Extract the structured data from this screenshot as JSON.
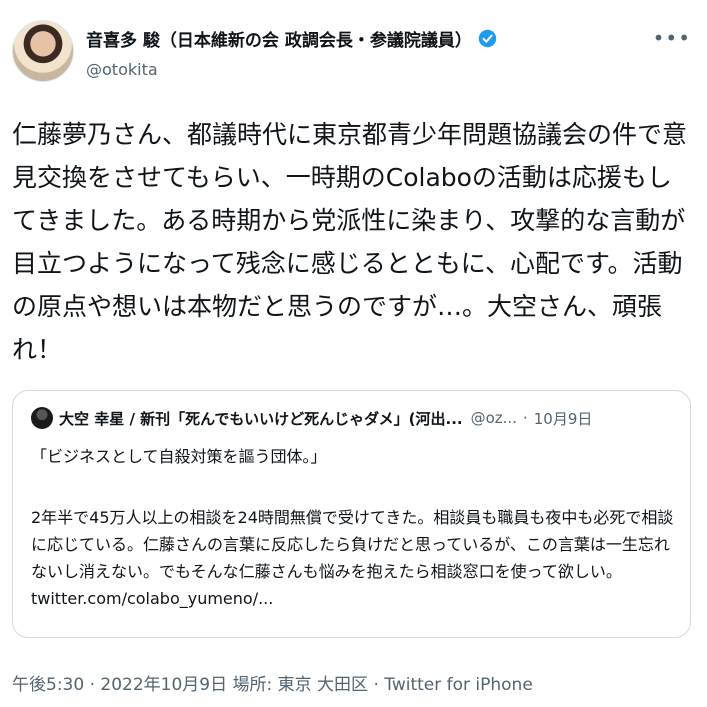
{
  "author": {
    "name": "音喜多 駿（日本維新の会 政調会長・参議院議員）",
    "handle": "@otokita",
    "verified": true,
    "avatar_icon": "profile-photo"
  },
  "more_icon": "more-options-icon",
  "tweet": {
    "text": "仁藤夢乃さん、都議時代に東京都青少年問題協議会の件で意見交換をさせてもらい、一時期のColaboの活動は応援もしてきました。ある時期から党派性に染まり、攻撃的な言動が目立つようになって残念に感じるとともに、心配です。活動の原点や想いは本物だと思うのですが…。大空さん、頑張れ！"
  },
  "quoted_tweet": {
    "name": "大空 幸星 / 新刊「死んでもいいけど死んじゃダメ」(河出...",
    "handle": "@oz...",
    "separator": "·",
    "date": "10月9日",
    "headline": "「ビジネスとして自殺対策を謳う団体。」",
    "body": "2年半で45万人以上の相談を24時間無償で受けてきた。相談員も職員も夜中も必死で相談に応じている。仁藤さんの言葉に反応したら負けだと思っているが、この言葉は一生忘れないし消えない。でもそんな仁藤さんも悩みを抱えたら相談窓口を使って欲しい。",
    "link": "twitter.com/colabo_yumeno/..."
  },
  "footer": {
    "meta": "午後5:30 · 2022年10月9日 場所: 東京 大田区 · Twitter for iPhone"
  },
  "colors": {
    "verified_badge": "#1d9bf0",
    "secondary_text": "#536471",
    "border": "#cfd9de"
  }
}
